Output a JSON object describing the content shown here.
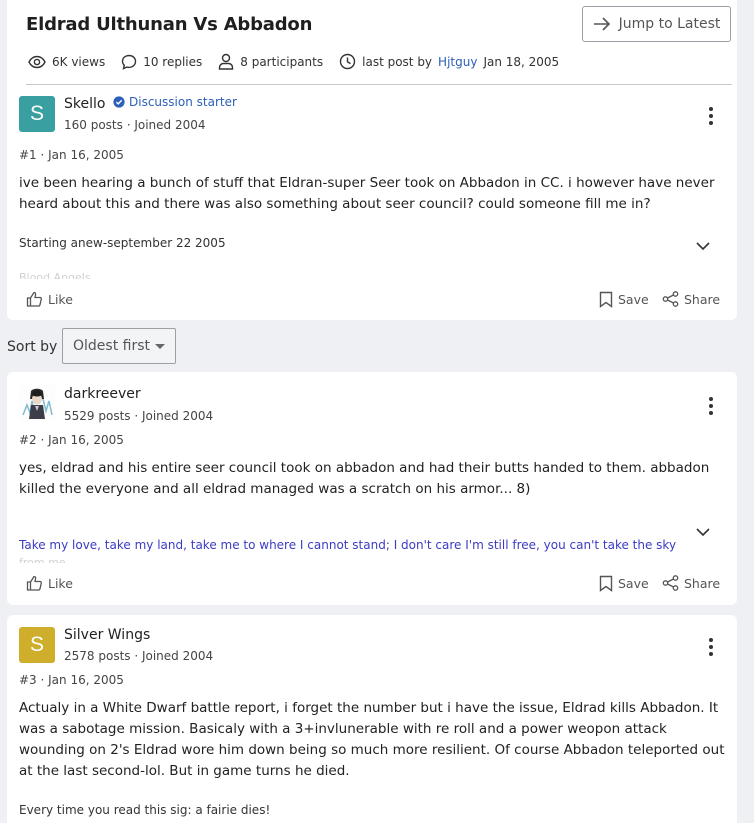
{
  "thread": {
    "title": "Eldrad Ulthunan Vs Abbadon",
    "jump_label": "Jump to Latest",
    "views": "6K views",
    "replies": "10 replies",
    "participants": "8 participants",
    "last_post_prefix": "last post by",
    "last_post_user": "Hjtguy",
    "last_post_date": "Jan 18, 2005"
  },
  "sort": {
    "label": "Sort by",
    "selected": "Oldest first"
  },
  "colors": {
    "link": "#2b5fb8",
    "sig_blue": "#3b3bc4",
    "avatar_skello": "#3a9fa0",
    "avatar_silver": "#cfae2c"
  },
  "posts": [
    {
      "avatar_letter": "S",
      "username": "Skello",
      "badge": "Discussion starter",
      "stats": "160 posts · Joined 2004",
      "number": "#1 · Jan 16, 2005",
      "body": "ive been hearing a bunch of stuff that Eldran-super Seer took on Abbadon in CC. i however have never heard about this and there was also something about seer council? could someone fill me in?",
      "signature": "Starting anew-september 22 2005",
      "signature_more": "Blood Angels",
      "like": "Like",
      "save": "Save",
      "share": "Share"
    },
    {
      "username": "darkreever",
      "stats": "5529 posts · Joined 2004",
      "number": "#2 · Jan 16, 2005",
      "body": "yes, eldrad and his entire seer council took on abbadon and had their butts handed to them. abbadon killed the everyone and all eldrad managed was a scratch on his armor... 8)",
      "signature": "Take my love, take my land, take me to where I cannot stand; I don't care I'm still free, you can't take the sky",
      "signature_more": "from me",
      "like": "Like",
      "save": "Save",
      "share": "Share"
    },
    {
      "avatar_letter": "S",
      "username": "Silver Wings",
      "stats": "2578 posts · Joined 2004",
      "number": "#3 · Jan 16, 2005",
      "body": "Actualy in a White Dwarf battle report, i forget the number but i have the issue, Eldrad kills Abbadon. It was a sabotage mission. Basicaly with a 3+invlunerable with re roll and a power weopon attack wounding on 2's Eldrad wore him down being so much more resilient. Of course Abbadon teleported out at the last second-lol. But in game turns he died.",
      "signature": "Every time you read this sig: a fairie dies!"
    }
  ]
}
